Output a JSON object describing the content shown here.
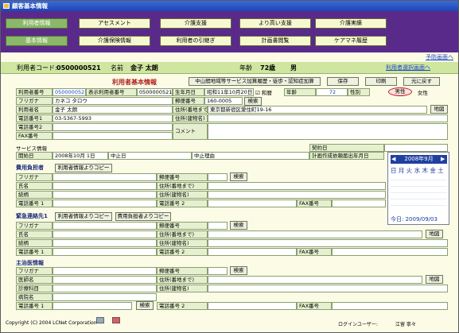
{
  "window": {
    "title": "顧客基本情報"
  },
  "nav": {
    "row1": [
      "利用者情報",
      "アセスメント",
      "介護支援",
      "より高い支援",
      "介護実績"
    ],
    "row2": [
      "基本情報",
      "介護保険情報",
      "利用者の引継ぎ",
      "計画書閲覧",
      "ケアマネ履歴"
    ]
  },
  "links": {
    "prev_screen": "予防画面へ",
    "user_select": "利用者選択画面へ"
  },
  "user": {
    "code_label": "利用者コード:",
    "code": "0500000521",
    "name_label": "名前",
    "name": "金子 太朗",
    "age_label": "年齢",
    "age": "72歳",
    "sex": "男"
  },
  "basic": {
    "title": "利用者基本情報",
    "surcharge_button": "中山間地域等サービス加算履歴・徒歩・認知症加算",
    "save": "保存",
    "print": "印刷",
    "back": "元に戻す",
    "user_no_label": "利用者番号",
    "user_no": "0500000521",
    "disp_no_label": "表示利用者番号",
    "disp_no": "0500000521",
    "birth_label": "生年月日",
    "birth_date": "昭和11年10月20日",
    "era": "☑ 和暦",
    "age_label": "年齢",
    "age_value": "72",
    "sex_label": "性別",
    "male": "男性",
    "female": "女性",
    "kana_label": "フリガナ",
    "kana": "カネコ タロウ",
    "postal_label": "郵便番号",
    "postal": "160-0005",
    "search": "検索",
    "name_label": "利用者名",
    "name": "金子 太朗",
    "addr_label": "住所(番地まで)",
    "addr": "東京都新宿区愛住町19-16",
    "map": "地図",
    "tel1_label": "電話番号1",
    "tel1": "03-5367-5993",
    "bldg_label": "住所(建物名)",
    "tel2_label": "電話番号2",
    "fax_label": "FAX番号",
    "comment_label": "コメント"
  },
  "service": {
    "label": "サービス情報",
    "start_label": "開始日",
    "start": "2008年10月 1日",
    "suspend": "中止日",
    "reason": "中止理由",
    "contract_label": "契約日",
    "plan_label": "計画作成依頼届出年月日"
  },
  "calendar": {
    "month": "2008年9月",
    "week_head": "日 月 火 水 木 金 土",
    "today_label": "今日: 2009/09/03"
  },
  "payer": {
    "title": "費用負担者",
    "copy": "利用者情報よりコピー",
    "kana": "フリガナ",
    "name": "氏名",
    "relation": "続柄",
    "tel1": "電話番号 1",
    "postal": "郵便番号",
    "addr": "住所(番地まで)",
    "bldg": "住所(建物名)",
    "tel2": "電話番号 2",
    "search": "検索",
    "fax": "FAX番号"
  },
  "emergency": {
    "title": "緊急連絡先1",
    "copy": "利用者情報よりコピー",
    "copy2": "費用負担者よりコピー",
    "kana": "フリガナ",
    "name": "氏名",
    "relation": "続柄",
    "tel1": "電話番号 1",
    "postal": "郵便番号",
    "addr": "住所(番地まで)",
    "bldg": "住所(建物名)",
    "tel2": "電話番号 2",
    "search": "検索",
    "fax": "FAX番号",
    "map": "地図"
  },
  "doctor": {
    "title": "主治医情報",
    "kana": "フリガナ",
    "name": "医師名",
    "dept": "診療科目",
    "hosp": "病院名",
    "tel1": "電話番号 1",
    "search": "検索",
    "postal": "郵便番号",
    "addr": "住所(番地まで)",
    "bldg": "住所(建物名)",
    "tel2": "電話番号 2",
    "fax": "FAX番号",
    "map": "地図"
  },
  "footer": {
    "copyright": "Copyright (C) 2004 LCNet Corporation",
    "login": "ログインユーザー:",
    "user": "江留 寧々"
  }
}
